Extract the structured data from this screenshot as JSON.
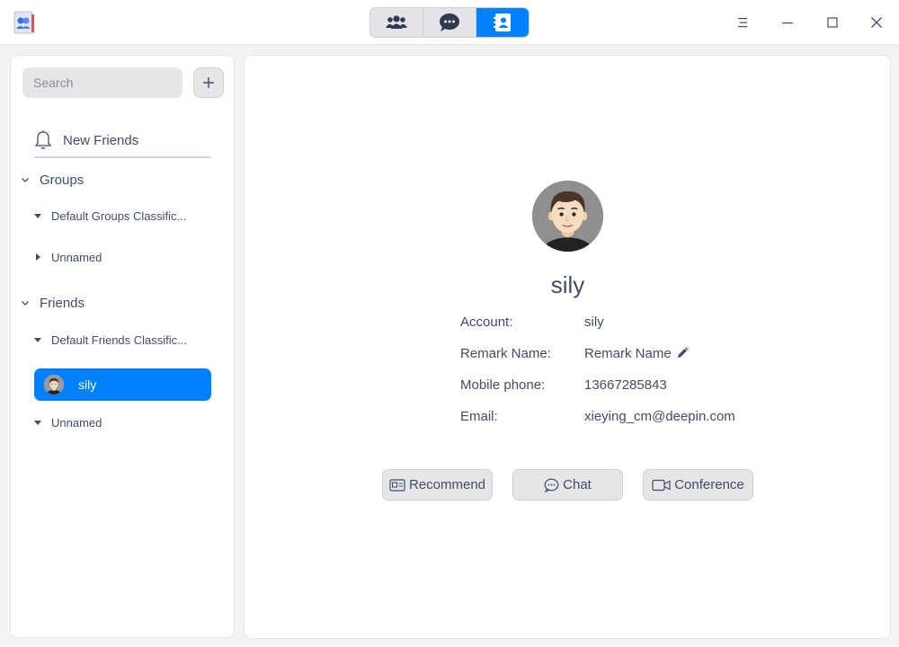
{
  "titlebar": {
    "tabs": [
      {
        "icon": "group-icon",
        "active": false
      },
      {
        "icon": "chat-bubble-icon",
        "active": false
      },
      {
        "icon": "contacts-icon",
        "active": true
      }
    ],
    "controls": [
      "menu-icon",
      "minimize-icon",
      "maximize-icon",
      "close-icon"
    ],
    "accent": "#0081ff"
  },
  "sidebar": {
    "search_placeholder": "Search",
    "new_friends": "New Friends",
    "groups": {
      "label": "Groups",
      "items": [
        {
          "label": "Default Groups Classific...",
          "expanded": true
        },
        {
          "label": "Unnamed",
          "expanded": false
        }
      ]
    },
    "friends": {
      "label": "Friends",
      "items": [
        {
          "label": "Default Friends Classific...",
          "expanded": true,
          "members": [
            {
              "name": "sily",
              "selected": true
            }
          ]
        },
        {
          "label": "Unnamed",
          "expanded": true
        }
      ]
    }
  },
  "profile": {
    "name": "sily",
    "fields": [
      {
        "label": "Account:",
        "value": "sily"
      },
      {
        "label": "Remark Name:",
        "value": "Remark Name"
      },
      {
        "label": "Mobile phone:",
        "value": "13667285843"
      },
      {
        "label": "Email:",
        "value": "xieying_cm@deepin.com"
      }
    ],
    "actions": {
      "recommend": "Recommend",
      "chat": "Chat",
      "conference": "Conference"
    }
  }
}
